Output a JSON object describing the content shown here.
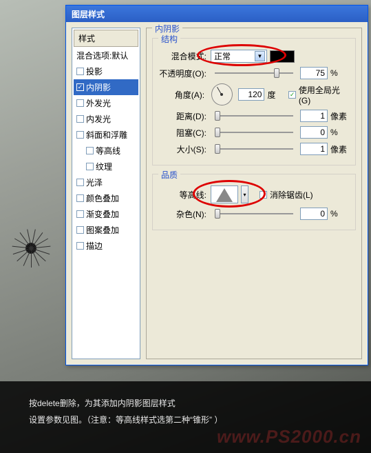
{
  "dialog": {
    "title": "图层样式"
  },
  "styles": {
    "header": "样式",
    "blend_defaults": "混合选项:默认",
    "drop_shadow": "投影",
    "inner_shadow": "内阴影",
    "outer_glow": "外发光",
    "inner_glow": "内发光",
    "bevel": "斜面和浮雕",
    "contour_sub": "等高线",
    "texture_sub": "纹理",
    "satin": "光泽",
    "color_overlay": "颜色叠加",
    "gradient_overlay": "渐变叠加",
    "pattern_overlay": "图案叠加",
    "stroke": "描边"
  },
  "panel": {
    "title": "内阴影",
    "structure": "结构",
    "blend_mode_label": "混合模式:",
    "blend_mode_value": "正常",
    "opacity_label": "不透明度(O):",
    "opacity_value": "75",
    "opacity_unit": "%",
    "angle_label": "角度(A):",
    "angle_value": "120",
    "angle_unit": "度",
    "global_light": "使用全局光(G)",
    "distance_label": "距离(D):",
    "distance_value": "1",
    "distance_unit": "像素",
    "choke_label": "阻塞(C):",
    "choke_value": "0",
    "choke_unit": "%",
    "size_label": "大小(S):",
    "size_value": "1",
    "size_unit": "像素",
    "quality": "品质",
    "contour_label": "等高线:",
    "antialias": "消除锯齿(L)",
    "noise_label": "杂色(N):",
    "noise_value": "0",
    "noise_unit": "%"
  },
  "caption": {
    "line1": "按delete删除，为其添加内阴影图层样式",
    "line2": "设置参数见图。（注意：等高线样式选第二种“锥形” ）"
  },
  "watermark": "www.PS2000.cn"
}
